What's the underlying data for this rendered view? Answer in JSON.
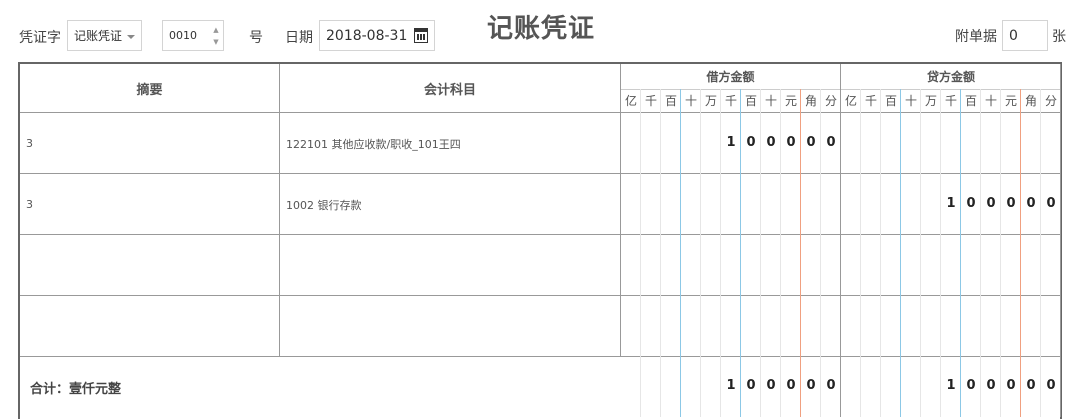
{
  "header": {
    "voucher_type_label": "凭证字",
    "voucher_type_value": "记账凭证",
    "voucher_number": "0010",
    "number_suffix": "号",
    "date_label": "日期",
    "date_value": "2018-08-31",
    "title": "记账凭证",
    "attachments_label": "附单据",
    "attachments_value": "0",
    "attachments_unit": "张"
  },
  "table": {
    "col_summary": "摘要",
    "col_account": "会计科目",
    "col_debit": "借方金额",
    "col_credit": "贷方金额",
    "units": [
      "亿",
      "千",
      "百",
      "十",
      "万",
      "千",
      "百",
      "十",
      "元",
      "角",
      "分"
    ],
    "rows": [
      {
        "summary": "3",
        "account": "122101 其他应收款/职收_101王四",
        "debit": "100000",
        "credit": ""
      },
      {
        "summary": "3",
        "account": "1002 银行存款",
        "debit": "",
        "credit": "100000"
      },
      {
        "summary": "",
        "account": "",
        "debit": "",
        "credit": ""
      },
      {
        "summary": "",
        "account": "",
        "debit": "",
        "credit": ""
      }
    ],
    "total_label": "合计：壹仟元整",
    "total_debit": "100000",
    "total_credit": "100000"
  }
}
